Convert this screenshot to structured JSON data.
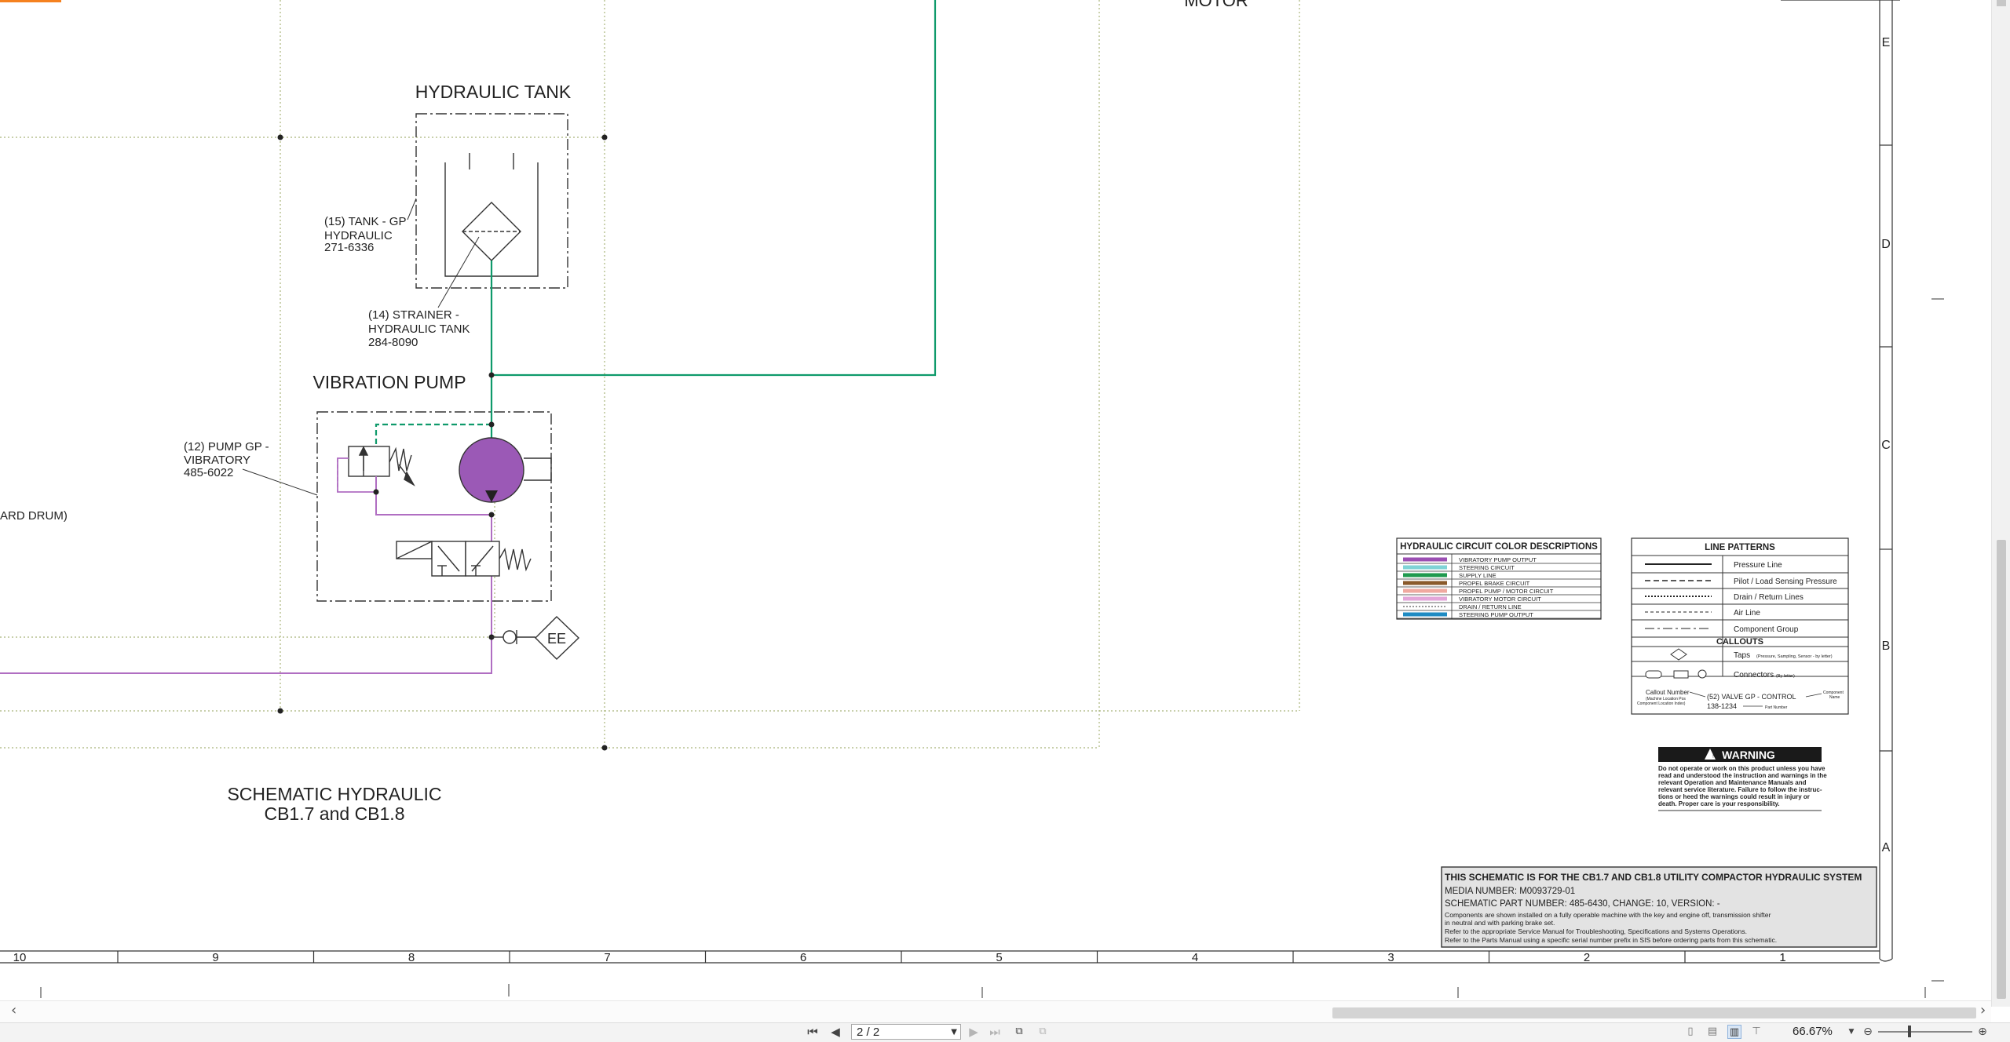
{
  "schematic": {
    "titles": {
      "hydraulic_tank": "HYDRAULIC TANK",
      "vibration_pump": "VIBRATION PUMP",
      "motor_partial": "MOTOR",
      "schematic_title_1": "SCHEMATIC HYDRAULIC",
      "schematic_title_2": "CB1.7 and CB1.8"
    },
    "callouts": {
      "tank": [
        "(15) TANK - GP",
        "HYDRAULIC",
        "271-6336"
      ],
      "strainer": [
        "(14) STRAINER -",
        "HYDRAULIC TANK",
        "284-8090"
      ],
      "pump": [
        "(12) PUMP GP -",
        "VIBRATORY",
        "485-6022"
      ],
      "drum_partial": "ARD DRUM)",
      "tap": "EE"
    },
    "row_labels": [
      "E",
      "D",
      "C",
      "B",
      "A"
    ],
    "column_labels": [
      "10",
      "9",
      "8",
      "7",
      "6",
      "5",
      "4",
      "3",
      "2",
      "1"
    ],
    "colors": {
      "pressure": "#0f9a6b",
      "vibratory": "#9b59b6",
      "vibratory_line": "#b06ec2",
      "grid": "#a9b57a"
    },
    "color_legend": {
      "title": "HYDRAULIC CIRCUIT COLOR DESCRIPTIONS",
      "items": [
        {
          "label": "VIBRATORY PUMP OUTPUT",
          "color": "#9b4fb3",
          "style": "solid"
        },
        {
          "label": "STEERING CIRCUIT",
          "color": "#7fd3d6",
          "style": "solid"
        },
        {
          "label": "SUPPLY LINE",
          "color": "#1f9a4e",
          "style": "solid"
        },
        {
          "label": "PROPEL BRAKE CIRCUIT",
          "color": "#8a5a2b",
          "style": "solid"
        },
        {
          "label": "PROPEL PUMP / MOTOR CIRCUIT",
          "color": "#f0a9a0",
          "style": "solid"
        },
        {
          "label": "VIBRATORY MOTOR CIRCUIT",
          "color": "#e3a6d9",
          "style": "solid"
        },
        {
          "label": "DRAIN / RETURN LINE",
          "color": "#9a9a9a",
          "style": "dotted"
        },
        {
          "label": "STEERING PUMP OUTPUT",
          "color": "#1e8bc3",
          "style": "solid"
        }
      ]
    },
    "line_patterns": {
      "title": "LINE PATTERNS",
      "items": [
        "Pressure Line",
        "Pilot / Load Sensing Pressure",
        "Drain / Return Lines",
        "Air Line",
        "Component Group"
      ],
      "callouts_title": "CALLOUTS",
      "taps_label": "Taps",
      "taps_note": "(Pressure, Sampling, Sensor - by letter)",
      "connectors_label": "Connectors",
      "connectors_note": "(By letter)",
      "callout_number": "Callout Number",
      "callout_note_1": "(Machine Location Pos",
      "callout_note_2": "Component Location Index)",
      "callout_example": "(52) VALVE GP - CONTROL",
      "callout_part": "138-1234",
      "component_name_1": "Component",
      "component_name_2": "Name",
      "part_number_label": "Part Number"
    },
    "warning": {
      "title": "WARNING",
      "lines": [
        "Do not operate or work on this product unless you have",
        "read and understood the instruction and warnings in the",
        "relevant Operation and Maintenance Manuals and",
        "relevant service literature. Failure to follow the instruc-",
        "tions or heed the warnings could result in injury or",
        "death. Proper care is your responsibility."
      ]
    },
    "info": {
      "line1": "THIS SCHEMATIC IS FOR THE CB1.7 AND CB1.8 UTILITY COMPACTOR HYDRAULIC SYSTEM",
      "line2": "MEDIA NUMBER: M0093729-01",
      "line3": "SCHEMATIC PART NUMBER: 485-6430, CHANGE: 10, VERSION: -",
      "line4": "Components are shown installed on a fully operable machine with the key and engine off, transmission shifter",
      "line5": "in neutral and with parking brake set.",
      "line6": "Refer to the appropriate Service Manual for Troubleshooting, Specifications and Systems Operations.",
      "line7": "Refer to the Parts Manual using a specific serial number prefix in SIS before ordering parts from this schematic."
    }
  },
  "toolbar": {
    "page_value": "2 / 2",
    "zoom_label": "66.67%",
    "zoom_level_percent": 66.67,
    "first_icon": "first-page-icon",
    "prev_icon": "previous-page-icon",
    "next_icon": "next-page-icon",
    "last_icon": "last-page-icon"
  }
}
